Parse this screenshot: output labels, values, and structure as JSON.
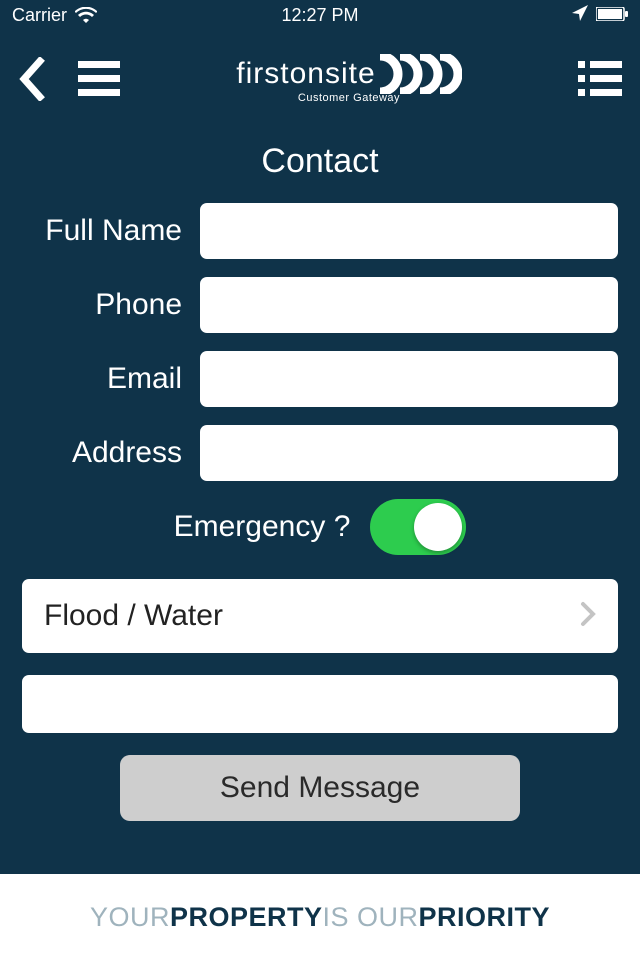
{
  "status": {
    "carrier": "Carrier",
    "time": "12:27 PM"
  },
  "brand": {
    "name": "firstonsite",
    "tagline": "Customer Gateway"
  },
  "page_title": "Contact",
  "form": {
    "full_name_label": "Full Name",
    "phone_label": "Phone",
    "email_label": "Email",
    "address_label": "Address",
    "emergency_label": "Emergency ?",
    "emergency_on": true,
    "category_selected": "Flood / Water",
    "submit_label": "Send Message"
  },
  "footer": {
    "w1": "YOUR ",
    "w2": "PROPERTY",
    "w3": " IS OUR ",
    "w4": "PRIORITY"
  }
}
